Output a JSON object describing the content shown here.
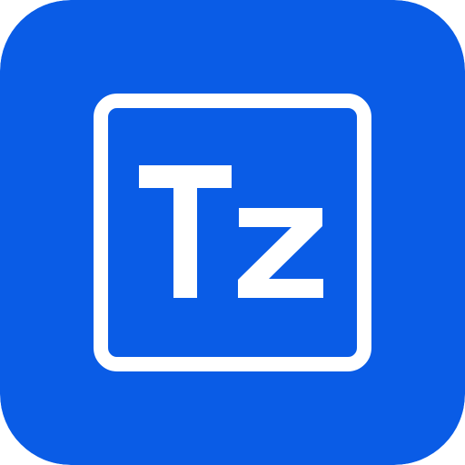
{
  "icon": {
    "name": "tz-app-icon",
    "glyph": {
      "letters": "Tz"
    },
    "colors": {
      "background": "#0a5ce6",
      "foreground": "#ffffff"
    }
  }
}
